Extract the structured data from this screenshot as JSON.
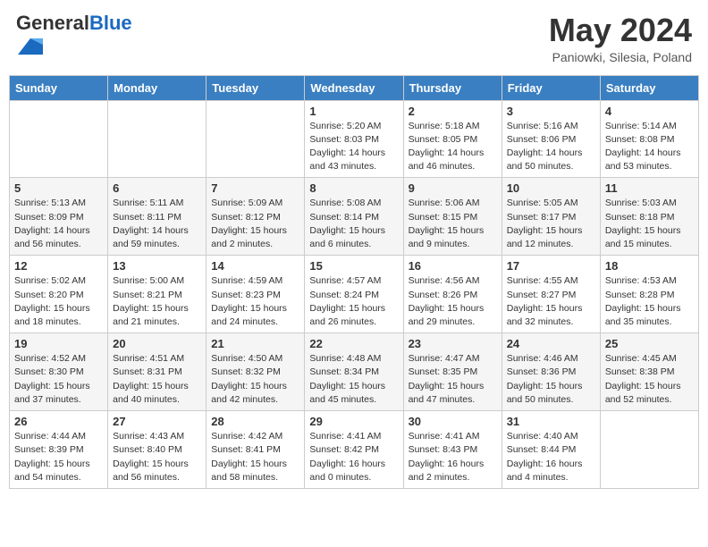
{
  "header": {
    "logo_general": "General",
    "logo_blue": "Blue",
    "month_title": "May 2024",
    "subtitle": "Paniowki, Silesia, Poland"
  },
  "weekdays": [
    "Sunday",
    "Monday",
    "Tuesday",
    "Wednesday",
    "Thursday",
    "Friday",
    "Saturday"
  ],
  "weeks": [
    [
      {
        "day": "",
        "info": ""
      },
      {
        "day": "",
        "info": ""
      },
      {
        "day": "",
        "info": ""
      },
      {
        "day": "1",
        "info": "Sunrise: 5:20 AM\nSunset: 8:03 PM\nDaylight: 14 hours and 43 minutes."
      },
      {
        "day": "2",
        "info": "Sunrise: 5:18 AM\nSunset: 8:05 PM\nDaylight: 14 hours and 46 minutes."
      },
      {
        "day": "3",
        "info": "Sunrise: 5:16 AM\nSunset: 8:06 PM\nDaylight: 14 hours and 50 minutes."
      },
      {
        "day": "4",
        "info": "Sunrise: 5:14 AM\nSunset: 8:08 PM\nDaylight: 14 hours and 53 minutes."
      }
    ],
    [
      {
        "day": "5",
        "info": "Sunrise: 5:13 AM\nSunset: 8:09 PM\nDaylight: 14 hours and 56 minutes."
      },
      {
        "day": "6",
        "info": "Sunrise: 5:11 AM\nSunset: 8:11 PM\nDaylight: 14 hours and 59 minutes."
      },
      {
        "day": "7",
        "info": "Sunrise: 5:09 AM\nSunset: 8:12 PM\nDaylight: 15 hours and 2 minutes."
      },
      {
        "day": "8",
        "info": "Sunrise: 5:08 AM\nSunset: 8:14 PM\nDaylight: 15 hours and 6 minutes."
      },
      {
        "day": "9",
        "info": "Sunrise: 5:06 AM\nSunset: 8:15 PM\nDaylight: 15 hours and 9 minutes."
      },
      {
        "day": "10",
        "info": "Sunrise: 5:05 AM\nSunset: 8:17 PM\nDaylight: 15 hours and 12 minutes."
      },
      {
        "day": "11",
        "info": "Sunrise: 5:03 AM\nSunset: 8:18 PM\nDaylight: 15 hours and 15 minutes."
      }
    ],
    [
      {
        "day": "12",
        "info": "Sunrise: 5:02 AM\nSunset: 8:20 PM\nDaylight: 15 hours and 18 minutes."
      },
      {
        "day": "13",
        "info": "Sunrise: 5:00 AM\nSunset: 8:21 PM\nDaylight: 15 hours and 21 minutes."
      },
      {
        "day": "14",
        "info": "Sunrise: 4:59 AM\nSunset: 8:23 PM\nDaylight: 15 hours and 24 minutes."
      },
      {
        "day": "15",
        "info": "Sunrise: 4:57 AM\nSunset: 8:24 PM\nDaylight: 15 hours and 26 minutes."
      },
      {
        "day": "16",
        "info": "Sunrise: 4:56 AM\nSunset: 8:26 PM\nDaylight: 15 hours and 29 minutes."
      },
      {
        "day": "17",
        "info": "Sunrise: 4:55 AM\nSunset: 8:27 PM\nDaylight: 15 hours and 32 minutes."
      },
      {
        "day": "18",
        "info": "Sunrise: 4:53 AM\nSunset: 8:28 PM\nDaylight: 15 hours and 35 minutes."
      }
    ],
    [
      {
        "day": "19",
        "info": "Sunrise: 4:52 AM\nSunset: 8:30 PM\nDaylight: 15 hours and 37 minutes."
      },
      {
        "day": "20",
        "info": "Sunrise: 4:51 AM\nSunset: 8:31 PM\nDaylight: 15 hours and 40 minutes."
      },
      {
        "day": "21",
        "info": "Sunrise: 4:50 AM\nSunset: 8:32 PM\nDaylight: 15 hours and 42 minutes."
      },
      {
        "day": "22",
        "info": "Sunrise: 4:48 AM\nSunset: 8:34 PM\nDaylight: 15 hours and 45 minutes."
      },
      {
        "day": "23",
        "info": "Sunrise: 4:47 AM\nSunset: 8:35 PM\nDaylight: 15 hours and 47 minutes."
      },
      {
        "day": "24",
        "info": "Sunrise: 4:46 AM\nSunset: 8:36 PM\nDaylight: 15 hours and 50 minutes."
      },
      {
        "day": "25",
        "info": "Sunrise: 4:45 AM\nSunset: 8:38 PM\nDaylight: 15 hours and 52 minutes."
      }
    ],
    [
      {
        "day": "26",
        "info": "Sunrise: 4:44 AM\nSunset: 8:39 PM\nDaylight: 15 hours and 54 minutes."
      },
      {
        "day": "27",
        "info": "Sunrise: 4:43 AM\nSunset: 8:40 PM\nDaylight: 15 hours and 56 minutes."
      },
      {
        "day": "28",
        "info": "Sunrise: 4:42 AM\nSunset: 8:41 PM\nDaylight: 15 hours and 58 minutes."
      },
      {
        "day": "29",
        "info": "Sunrise: 4:41 AM\nSunset: 8:42 PM\nDaylight: 16 hours and 0 minutes."
      },
      {
        "day": "30",
        "info": "Sunrise: 4:41 AM\nSunset: 8:43 PM\nDaylight: 16 hours and 2 minutes."
      },
      {
        "day": "31",
        "info": "Sunrise: 4:40 AM\nSunset: 8:44 PM\nDaylight: 16 hours and 4 minutes."
      },
      {
        "day": "",
        "info": ""
      }
    ]
  ]
}
